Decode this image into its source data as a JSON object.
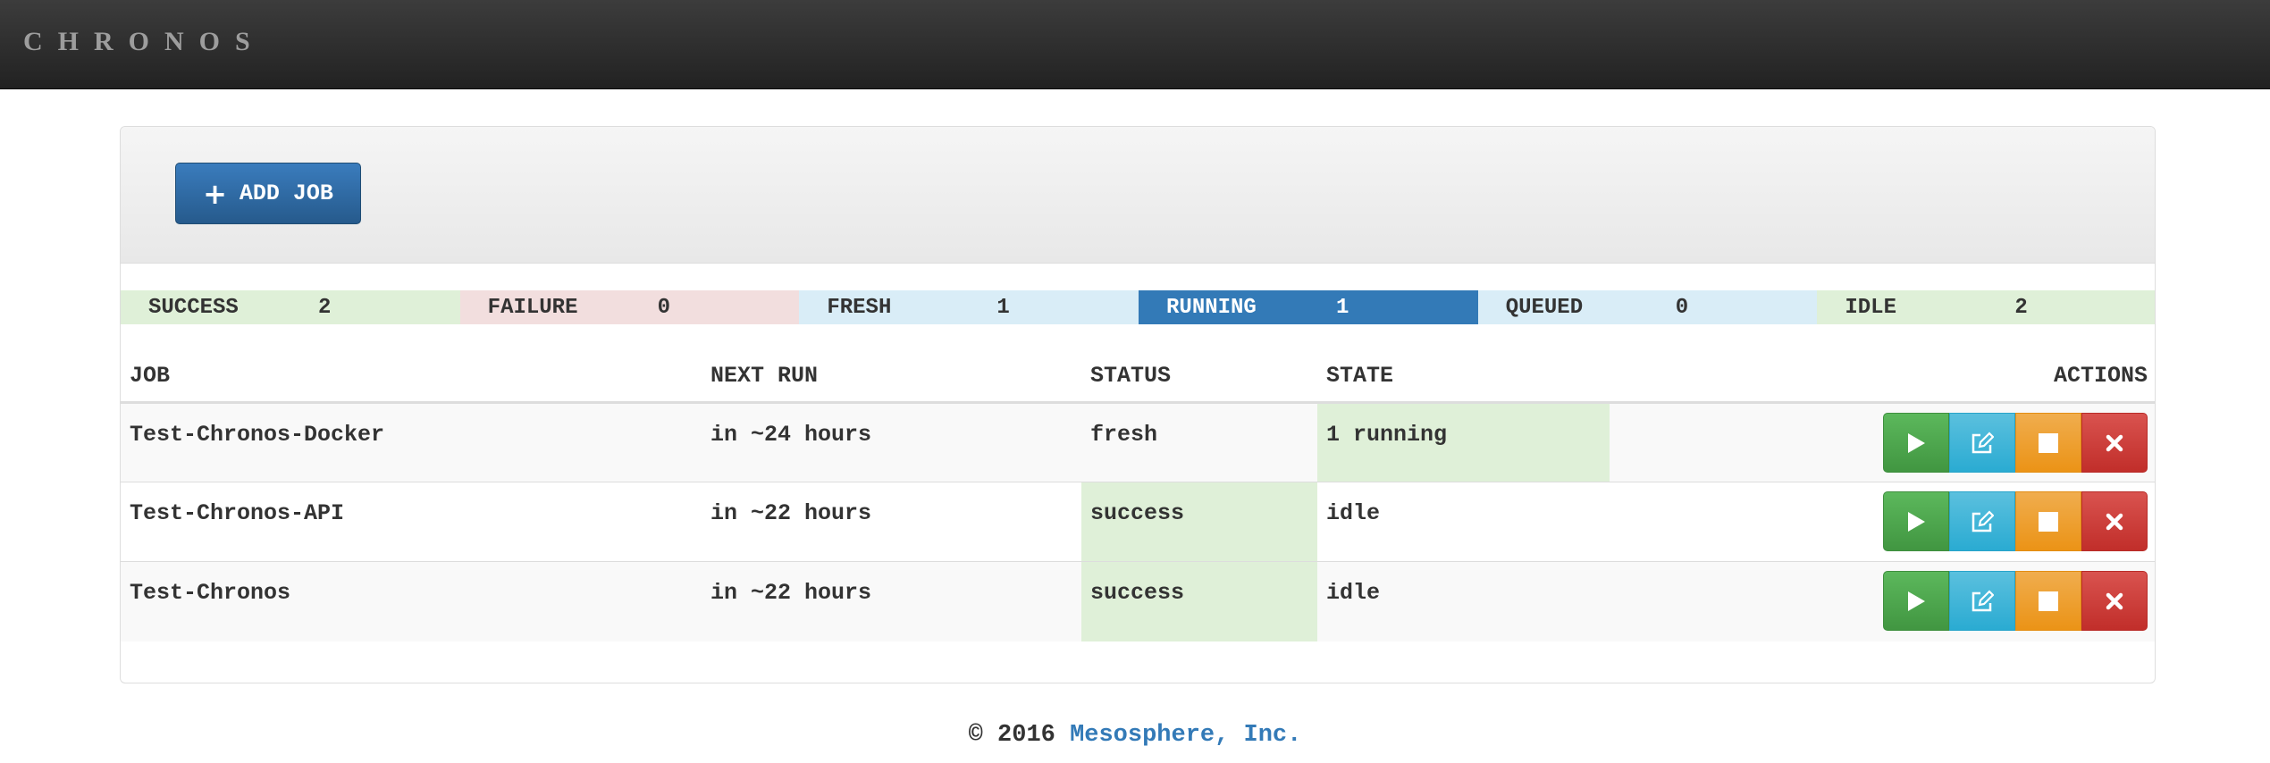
{
  "app": {
    "brand": "CHRONOS"
  },
  "toolbar": {
    "add_job_label": "ADD JOB",
    "add_job_icon": "plus-icon"
  },
  "counters": [
    {
      "label": "SUCCESS",
      "count": "2",
      "color": "#dff0d8"
    },
    {
      "label": "FAILURE",
      "count": "0",
      "color": "#f2dede"
    },
    {
      "label": "FRESH",
      "count": "1",
      "color": "#d9edf7"
    },
    {
      "label": "RUNNING",
      "count": "1",
      "color": "#337ab7"
    },
    {
      "label": "QUEUED",
      "count": "0",
      "color": "#d9edf7"
    },
    {
      "label": "IDLE",
      "count": "2",
      "color": "#dff0d8"
    }
  ],
  "table": {
    "headers": {
      "job": "JOB",
      "next_run": "NEXT RUN",
      "status": "STATUS",
      "state": "STATE",
      "actions": "ACTIONS"
    },
    "rows": [
      {
        "job": "Test-Chronos-Docker",
        "next_run": "in ~24 hours",
        "status": "fresh",
        "state": "1 running"
      },
      {
        "job": "Test-Chronos-API",
        "next_run": "in ~22 hours",
        "status": "success",
        "state": "idle"
      },
      {
        "job": "Test-Chronos",
        "next_run": "in ~22 hours",
        "status": "success",
        "state": "idle"
      }
    ],
    "action_icons": [
      "play-icon",
      "edit-icon",
      "stop-icon",
      "delete-icon"
    ]
  },
  "footer": {
    "copyright": "© 2016",
    "company": "Mesosphere, Inc."
  },
  "colors": {
    "run": "#5cb85c",
    "edit": "#5bc0de",
    "stop": "#f0ad4e",
    "delete": "#d9534f",
    "highlight": "#dff0d8"
  }
}
